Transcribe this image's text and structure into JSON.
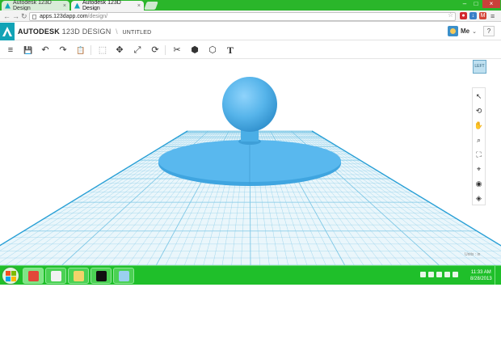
{
  "browser": {
    "tabs": [
      {
        "title": "Autodesk 123D Design",
        "active": false
      },
      {
        "title": "Autodesk 123D Design",
        "active": true
      }
    ],
    "url_host": "apps.123dapp.com",
    "url_path": "/design/",
    "tab_close_glyph": "×",
    "window_controls": {
      "minimize": "–",
      "maximize": "□",
      "close": "×"
    },
    "nav": {
      "back": "←",
      "forward": "→",
      "reload": "↻"
    },
    "extensions": [
      {
        "icon": "stop-extension-icon",
        "glyph": "●",
        "color": "#d3282e"
      },
      {
        "icon": "download-extension-icon",
        "glyph": "↓",
        "color": "#3a80c8"
      },
      {
        "icon": "gmail-extension-icon",
        "glyph": "M",
        "color": "#d44638"
      }
    ],
    "menu_glyph": "≡",
    "star_glyph": "☆"
  },
  "app": {
    "brand_primary": "AUTODESK",
    "brand_product": "123D",
    "brand_suffix": "DESIGN",
    "separator": "\\",
    "document_title": "UNTITLED",
    "user_name": "Me",
    "user_caret": "⌄",
    "help_label": "?",
    "accent_color": "#12a3b6"
  },
  "toolbar": {
    "main_menu": "≡",
    "save": "💾",
    "undo": "↶",
    "redo": "↷",
    "paste": "📋",
    "select": "⬚",
    "move": "✥",
    "scale": "⤢",
    "rotate": "⟳",
    "modify": "✂",
    "combine": "⬢",
    "group": "⬡",
    "text": "T"
  },
  "viewport": {
    "viewcube_label": "LEFT",
    "units_label": "Units : in",
    "nav_tools": [
      {
        "name": "select-icon",
        "glyph": "↖"
      },
      {
        "name": "orbit-icon",
        "glyph": "⟲"
      },
      {
        "name": "pan-icon",
        "glyph": "✋"
      },
      {
        "name": "zoom-icon",
        "glyph": "⌕"
      },
      {
        "name": "fit-icon",
        "glyph": "⛶"
      },
      {
        "name": "zoom-selected-icon",
        "glyph": "⌖"
      },
      {
        "name": "view-icon",
        "glyph": "◉"
      },
      {
        "name": "material-icon",
        "glyph": "◈"
      }
    ],
    "model_color": "#56b4ea",
    "grid_color": "#7fc8e6"
  },
  "taskbar": {
    "apps": [
      {
        "name": "chrome-task",
        "color": "#e2463a"
      },
      {
        "name": "gmail-task",
        "color": "#f2f2f2"
      },
      {
        "name": "explorer-task",
        "color": "#f3d36a"
      },
      {
        "name": "hp-task",
        "color": "#111111"
      },
      {
        "name": "paint-task",
        "color": "#9ad0ef"
      }
    ],
    "time": "11:33 AM",
    "date": "8/28/2013"
  }
}
